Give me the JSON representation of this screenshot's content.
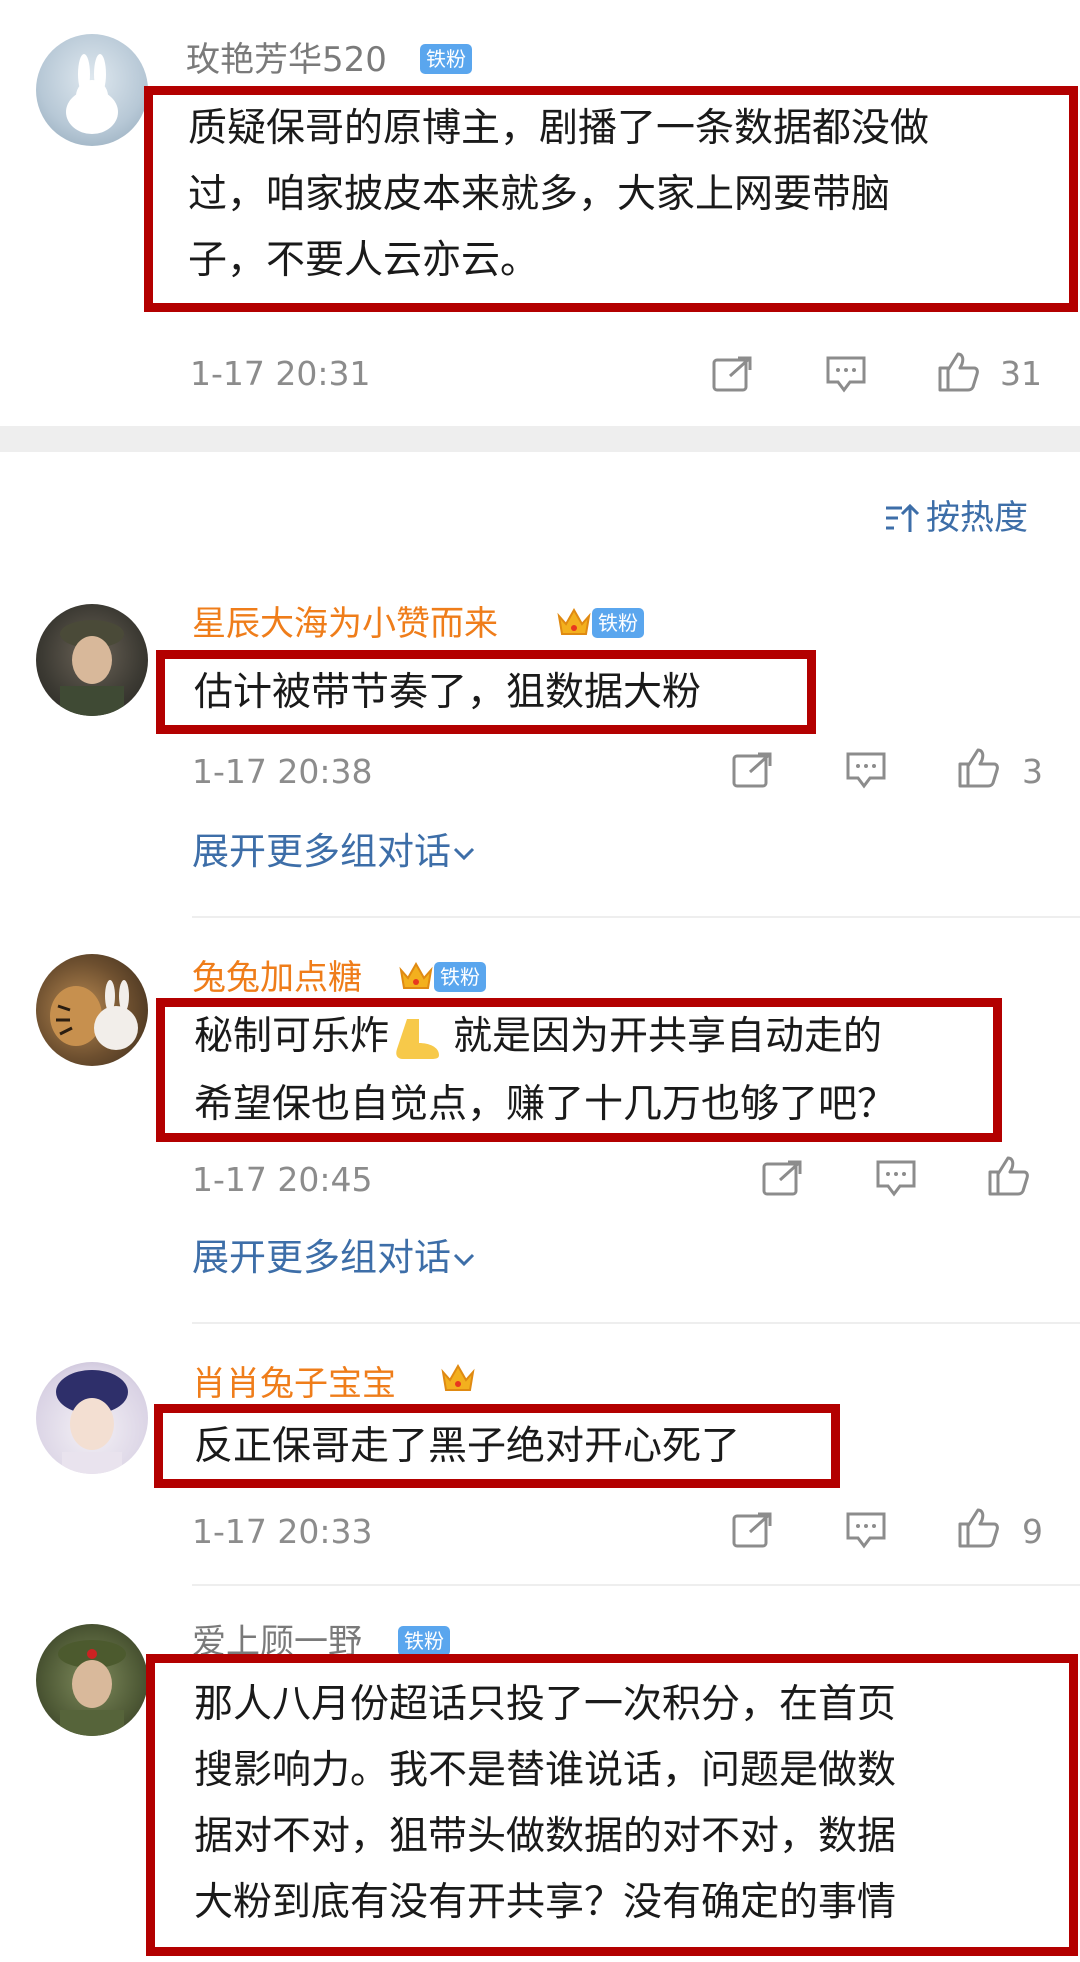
{
  "sort": {
    "label": "按热度"
  },
  "common": {
    "badge": "铁粉",
    "expand_label": "展开更多组对话"
  },
  "comments": [
    {
      "username": "玫艳芳华520",
      "lines": [
        "质疑保哥的原博主，剧播了一条数据都没做",
        "过，咱家披皮本来就多，大家上网要带脑",
        "子，不要人云亦云。"
      ],
      "time": "1-17 20:31",
      "likes": "31"
    },
    {
      "username": "星辰大海为小赞而来",
      "lines": [
        "估计被带节奏了，狙数据大粉"
      ],
      "time": "1-17 20:38",
      "likes": "3"
    },
    {
      "username": "兔兔加点糖",
      "lines": [
        "秘制可乐炸",
        "就是因为开共享自动走的",
        "希望保也自觉点，赚了十几万也够了吧？"
      ],
      "time": "1-17 20:45",
      "likes": ""
    },
    {
      "username": "肖肖兔子宝宝",
      "lines": [
        "反正保哥走了黑子绝对开心死了"
      ],
      "time": "1-17 20:33",
      "likes": "9"
    },
    {
      "username": "爱上顾一野",
      "lines": [
        "那人八月份超话只投了一次积分，在首页",
        "搜影响力。我不是替谁说话，问题是做数",
        "据对不对，狙带头做数据的对不对，数据",
        "大粉到底有没有开共享？没有确定的事情"
      ],
      "time": "",
      "likes": ""
    }
  ],
  "icons": {
    "share": "share-icon",
    "reply": "comment-icon",
    "like": "thumbs-up-icon",
    "crown": "crown-icon",
    "sort": "sort-icon",
    "chevron": "chevron-down-icon",
    "foot": "foot-emoji-icon"
  },
  "colors": {
    "highlight_box": "#b30000",
    "vip_name": "#ef7d1a",
    "plain_name": "#7a7a7a",
    "link": "#3d6ea8",
    "badge": "#5aa6ee",
    "meta": "#8c8c8c"
  }
}
